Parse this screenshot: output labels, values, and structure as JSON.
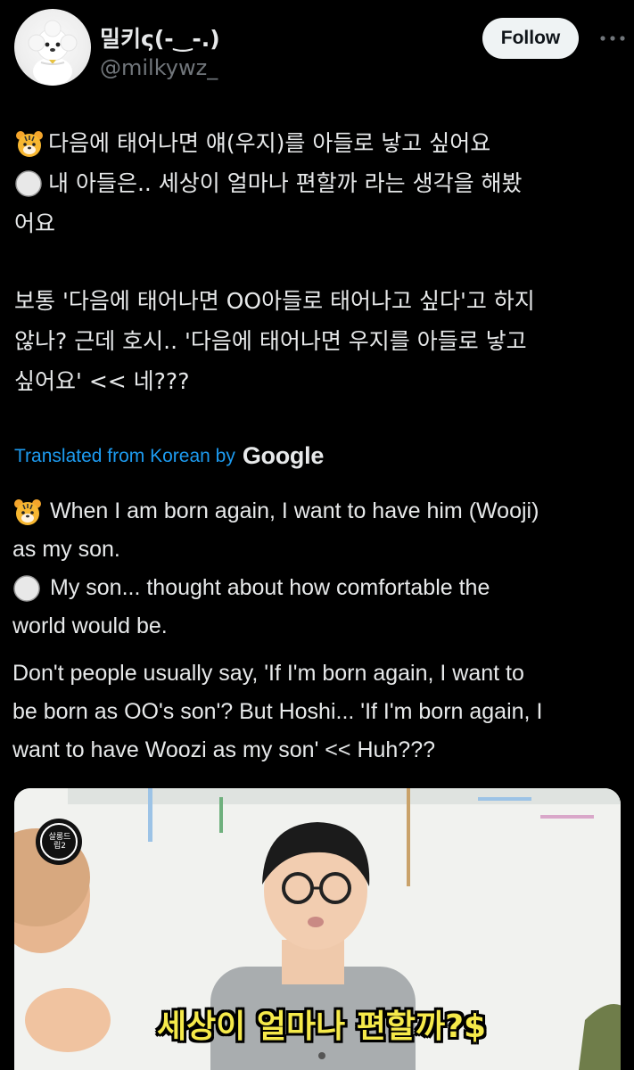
{
  "author": {
    "display_name": "밀키ς(-‿-.)",
    "handle": "@milkywz_"
  },
  "actions": {
    "follow_label": "Follow"
  },
  "icons": {
    "more": "more-horizontal-icon",
    "tiger_emoji": "tiger-face-emoji",
    "white_circle_emoji": "white-circle-emoji"
  },
  "post": {
    "line1": "다음에 태어나면 얘(우지)를 아들로 낳고 싶어요",
    "line2a": "내 아들은.. 세상이 얼마나 편할까 라는 생각을 해봤",
    "line2b": "어요",
    "p2_l1": "보통 '다음에 태어나면 OO아들로 태어나고 싶다'고 하지",
    "p2_l2": "않나? 근데 호시.. '다음에 태어나면 우지를 아들로 낳고",
    "p2_l3": "싶어요' << 네???"
  },
  "translation": {
    "label": "Translated from Korean by",
    "provider": "Google",
    "t1a": "When I am born again, I want to have him (Wooji)",
    "t1b": "as my son.",
    "t2a": "My son... thought about how comfortable the",
    "t2b": "world would be.",
    "t3a": "Don't people usually say, 'If I'm born again, I want to",
    "t3b": "be born as OO's son'? But Hoshi... 'If I'm born again, I",
    "t3c": "want to have Woozi as my son' << Huh???"
  },
  "media": {
    "caption": "세상이 얼마나 편할까?$",
    "logo_text": "살롱드립2"
  },
  "colors": {
    "background": "#000000",
    "text_primary": "#e7e9ea",
    "text_secondary": "#71767b",
    "link": "#1d9bf0",
    "follow_bg": "#eff3f4",
    "caption_yellow": "#f5e94a"
  }
}
